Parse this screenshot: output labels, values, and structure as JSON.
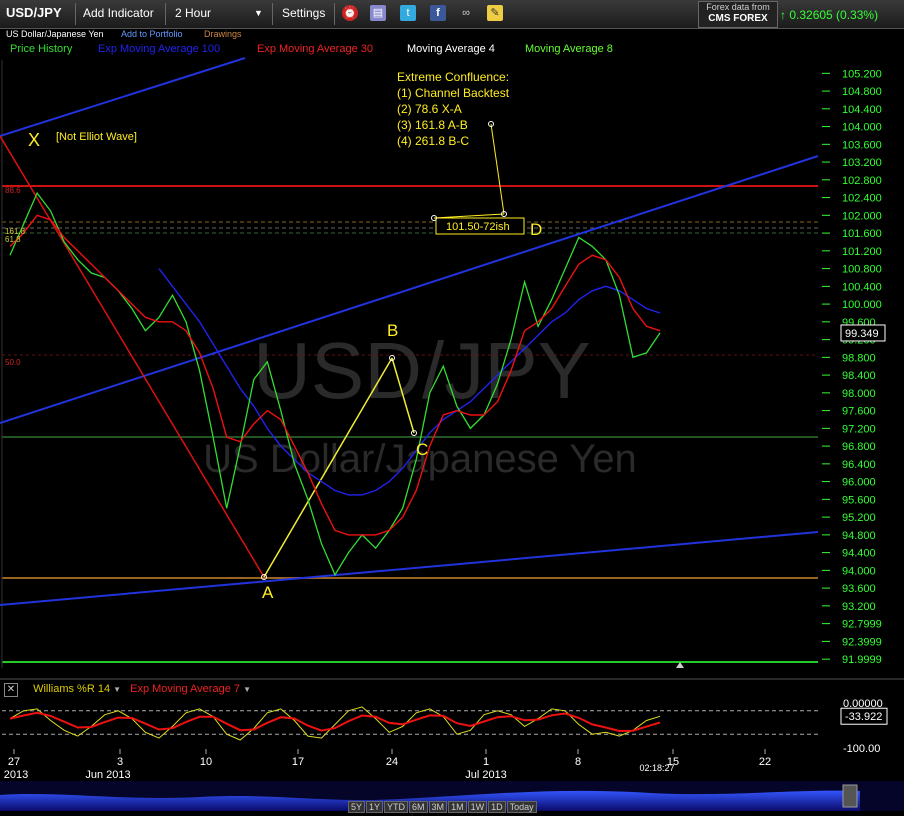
{
  "toolbar": {
    "symbol": "USD/JPY",
    "add_indicator": "Add Indicator",
    "interval": "2 Hour",
    "settings": "Settings",
    "forex_from": "Forex data from",
    "provider": "CMS FOREX",
    "change": "0.32605 (0.33%)"
  },
  "subbar": {
    "name": "US Dollar/Japanese Yen",
    "add_portfolio": "Add to Portfolio",
    "drawings": "Drawings"
  },
  "legend": {
    "price_history": "Price History",
    "ema100": "Exp Moving Average 100",
    "ema30": "Exp Moving Average 30",
    "ma4": "Moving Average 4",
    "ma8": "Moving Average 8"
  },
  "colors": {
    "price": "#33dd33",
    "ema100": "#2222ee",
    "ema30": "#ee1111",
    "ma4": "#ffffff",
    "ma8": "#66ff33",
    "annotation": "#ffee22",
    "axis_text": "#33ff33"
  },
  "chart_data": {
    "type": "line",
    "watermark_symbol": "USD/JPY",
    "watermark_name": "US Dollar/Japanese Yen",
    "ylim": [
      91.8,
      105.5
    ],
    "y_ticks": [
      "105.200",
      "104.800",
      "104.400",
      "104.000",
      "103.600",
      "103.200",
      "102.800",
      "102.400",
      "102.000",
      "101.600",
      "101.200",
      "100.800",
      "100.400",
      "100.000",
      "99.600",
      "99.200",
      "98.800",
      "98.400",
      "98.000",
      "97.600",
      "97.200",
      "96.800",
      "96.400",
      "96.000",
      "95.600",
      "95.200",
      "94.800",
      "94.400",
      "94.000",
      "93.600",
      "93.200",
      "92.7999",
      "92.3999",
      "91.9999"
    ],
    "last_price": "99.349",
    "x_ticks": [
      "27",
      "3",
      "10",
      "17",
      "24",
      "1",
      "8",
      "15",
      "22"
    ],
    "x_sub": [
      "2013",
      "Jun 2013",
      "Jul 2013"
    ],
    "time_label": "02:18:27",
    "series": [
      {
        "name": "Price History",
        "values": [
          101.1,
          101.8,
          102.5,
          102.1,
          101.4,
          101.0,
          100.7,
          100.6,
          100.3,
          99.9,
          99.4,
          99.7,
          100.2,
          99.6,
          98.5,
          97.0,
          95.4,
          96.8,
          98.3,
          98.7,
          97.6,
          96.4,
          95.6,
          94.6,
          93.9,
          94.4,
          94.8,
          94.5,
          94.9,
          95.4,
          96.5,
          98.0,
          98.6,
          97.7,
          97.2,
          97.5,
          98.2,
          99.2,
          100.5,
          99.5,
          100.1,
          100.8,
          101.5,
          101.3,
          101.0,
          100.2,
          98.8,
          98.9,
          99.35
        ]
      },
      {
        "name": "Exp Moving Average 100",
        "values": [
          null,
          null,
          null,
          null,
          null,
          null,
          null,
          null,
          null,
          null,
          null,
          100.8,
          100.4,
          100.0,
          99.6,
          99.1,
          98.6,
          98.1,
          97.7,
          97.2,
          96.8,
          96.5,
          96.2,
          96.0,
          95.8,
          95.7,
          95.7,
          95.8,
          96.0,
          96.3,
          96.7,
          97.1,
          97.4,
          97.6,
          97.8,
          98.1,
          98.4,
          98.7,
          99.0,
          99.3,
          99.6,
          99.8,
          100.1,
          100.3,
          100.4,
          100.3,
          100.1,
          99.9,
          99.8
        ]
      },
      {
        "name": "Exp Moving Average 30",
        "values": [
          101.3,
          101.6,
          102.0,
          101.9,
          101.5,
          101.2,
          100.9,
          100.6,
          100.3,
          100.0,
          99.7,
          99.6,
          99.6,
          99.4,
          98.9,
          98.1,
          97.0,
          96.9,
          97.3,
          97.6,
          97.4,
          96.8,
          96.2,
          95.5,
          94.9,
          94.8,
          94.8,
          94.8,
          94.9,
          95.2,
          95.8,
          96.8,
          97.5,
          97.6,
          97.5,
          97.5,
          97.8,
          98.5,
          99.4,
          99.6,
          99.9,
          100.4,
          100.9,
          101.1,
          101.0,
          100.6,
          99.9,
          99.5,
          99.4
        ]
      }
    ],
    "williams": {
      "name": "Williams %R 14",
      "ema_name": "Exp Moving Average 7",
      "ylim": [
        -100,
        0
      ],
      "y_ticks": [
        "0.00000",
        "-100.00"
      ],
      "last": "-33.922",
      "values": [
        -40,
        -20,
        -15,
        -45,
        -70,
        -85,
        -60,
        -30,
        -20,
        -40,
        -75,
        -90,
        -60,
        -25,
        -15,
        -35,
        -80,
        -95,
        -65,
        -25,
        -15,
        -45,
        -85,
        -90,
        -55,
        -20,
        -10,
        -40,
        -75,
        -60,
        -25,
        -15,
        -35,
        -80,
        -70,
        -30,
        -20,
        -30,
        -60,
        -40,
        -15,
        -20,
        -55,
        -80,
        -75,
        -85,
        -70,
        -45,
        -34
      ]
    },
    "annotations": {
      "confluence_title": "Extreme Confluence:",
      "confluence_1": "(1) Channel Backtest",
      "confluence_2": "(2) 78.6 X-A",
      "confluence_3": "(3) 161.8 A-B",
      "confluence_4": "(4) 261.8 B-C",
      "x_label": "X",
      "x_note": "[Not Elliot Wave]",
      "a_label": "A",
      "b_label": "B",
      "c_label": "C",
      "d_label": "D",
      "target_box": "101.50-72ish",
      "fib_886": "88.6",
      "fib_1618": "161.8",
      "fib_618": "61.8",
      "fib_50": "50.0"
    }
  },
  "range_buttons": [
    "5Y",
    "1Y",
    "YTD",
    "6M",
    "3M",
    "1M",
    "1W",
    "1D",
    "Today"
  ]
}
